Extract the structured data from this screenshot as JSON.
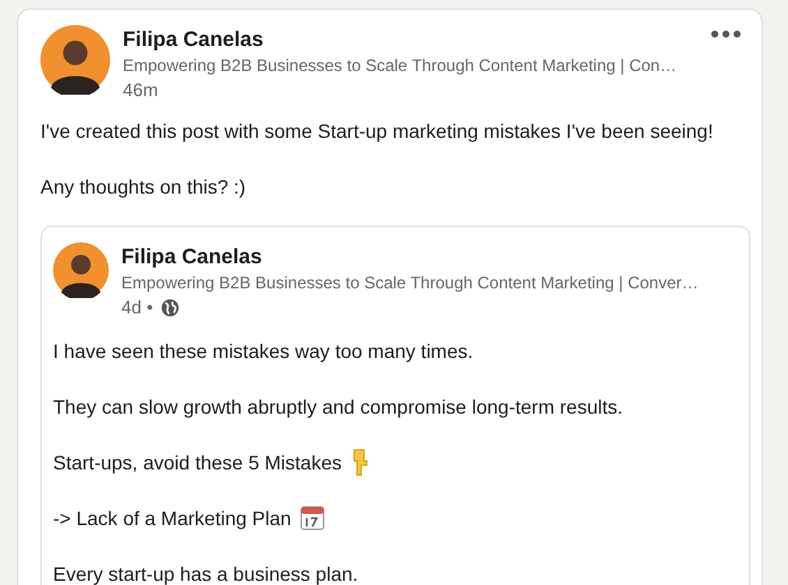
{
  "post": {
    "author": "Filipa Canelas",
    "headline": "Empowering B2B Businesses to Scale Through Content Marketing | Con…",
    "time": "46m",
    "paragraphs": [
      "I've created this post with some Start-up marketing mistakes I've been seeing!",
      "Any thoughts on this? :)"
    ],
    "shared": {
      "author": "Filipa Canelas",
      "headline": "Empowering B2B Businesses to Scale Through Content Marketing | Conver…",
      "time": "4d •",
      "paragraphs": [
        {
          "kind": "plain",
          "text": "I have seen these mistakes way too many times."
        },
        {
          "kind": "plain",
          "text": "They can slow growth abruptly and compromise long-term results."
        },
        {
          "kind": "hand",
          "text": "Start-ups, avoid these 5 Mistakes"
        },
        {
          "kind": "calendar",
          "text": "-> Lack of a Marketing Plan"
        },
        {
          "kind": "plain",
          "text": "Every start-up has a business plan."
        }
      ]
    }
  }
}
